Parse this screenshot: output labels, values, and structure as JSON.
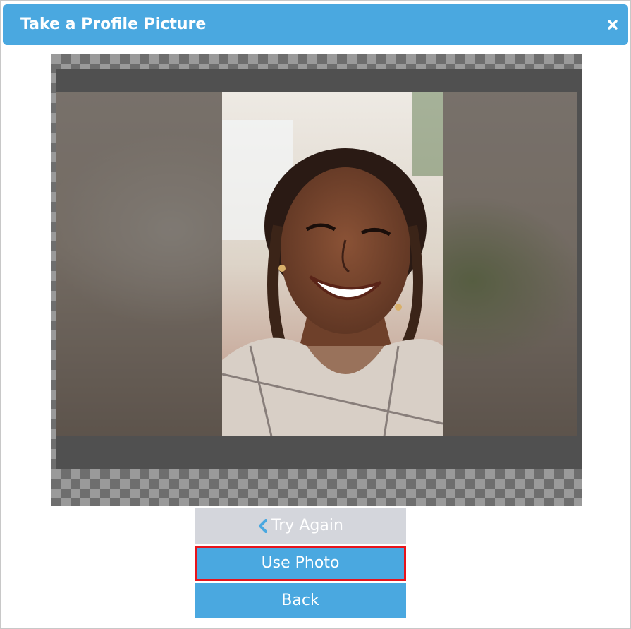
{
  "dialog": {
    "title": "Take a Profile Picture",
    "close_icon": "close-icon"
  },
  "buttons": {
    "try_again": "Try Again",
    "try_again_icon": "chevron-left-icon",
    "use_photo": "Use Photo",
    "back": "Back"
  },
  "colors": {
    "title_bar": "#4aa8e0",
    "primary_button": "#4aa8e0",
    "disabled_button": "#d4d6dc",
    "highlight_border": "#e8141b",
    "chevron": "#4aa8e0"
  }
}
